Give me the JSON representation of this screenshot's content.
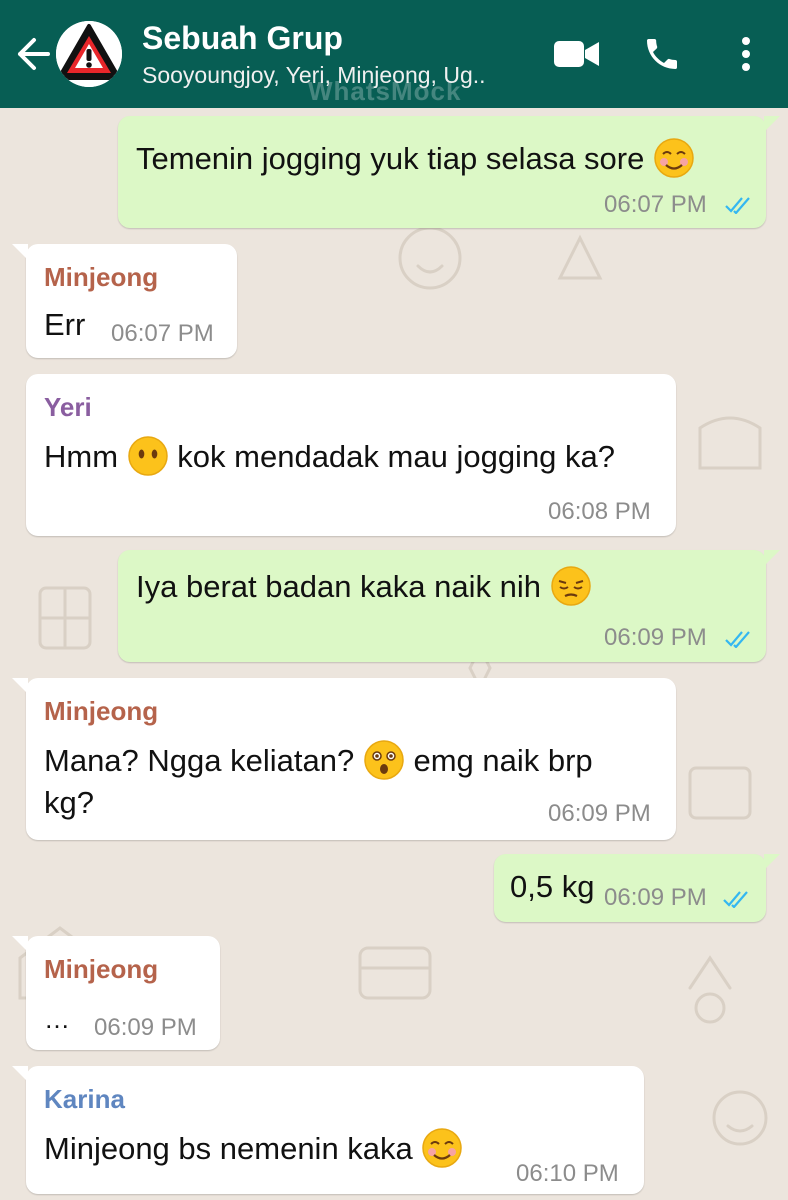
{
  "header": {
    "title": "Sebuah Grup",
    "participants": "Sooyoungjoy, Yeri, Minjeong, Ug..",
    "watermark": "WhatsMock",
    "colors": {
      "bar": "#075e54",
      "outgoing": "#dcf8c6",
      "incoming": "#ffffff",
      "read_ticks": "#34b7f1"
    }
  },
  "messages": [
    {
      "direction": "outgoing",
      "text": "Temenin jogging yuk tiap selasa sore",
      "emoji": "smiling-face-icon",
      "time": "06:07 PM",
      "status": "read"
    },
    {
      "direction": "incoming",
      "sender": "Minjeong",
      "sender_color": "#b5634b",
      "text": "Err",
      "time": "06:07 PM"
    },
    {
      "direction": "incoming",
      "sender": "Yeri",
      "sender_color": "#8a5ea0",
      "text_before": "Hmm",
      "emoji": "face-without-mouth-icon",
      "text_after": "kok mendadak mau jogging ka?",
      "time": "06:08 PM"
    },
    {
      "direction": "outgoing",
      "text": "Iya berat badan kaka naik nih",
      "emoji": "pensive-face-icon",
      "time": "06:09 PM",
      "status": "read"
    },
    {
      "direction": "incoming",
      "sender": "Minjeong",
      "sender_color": "#b5634b",
      "text_before": "Mana? Ngga keliatan?",
      "emoji": "astonished-face-icon",
      "text_after": "emg naik brp",
      "text_line2": "kg?",
      "time": "06:09 PM"
    },
    {
      "direction": "outgoing",
      "text": "0,5 kg",
      "time": "06:09 PM",
      "status": "read"
    },
    {
      "direction": "incoming",
      "sender": "Minjeong",
      "sender_color": "#b5634b",
      "text": "…",
      "time": "06:09 PM"
    },
    {
      "direction": "incoming",
      "sender": "Karina",
      "sender_color": "#5f86c0",
      "text": "Minjeong bs nemenin kaka",
      "emoji": "smiling-face-icon",
      "time": "06:10 PM"
    }
  ]
}
